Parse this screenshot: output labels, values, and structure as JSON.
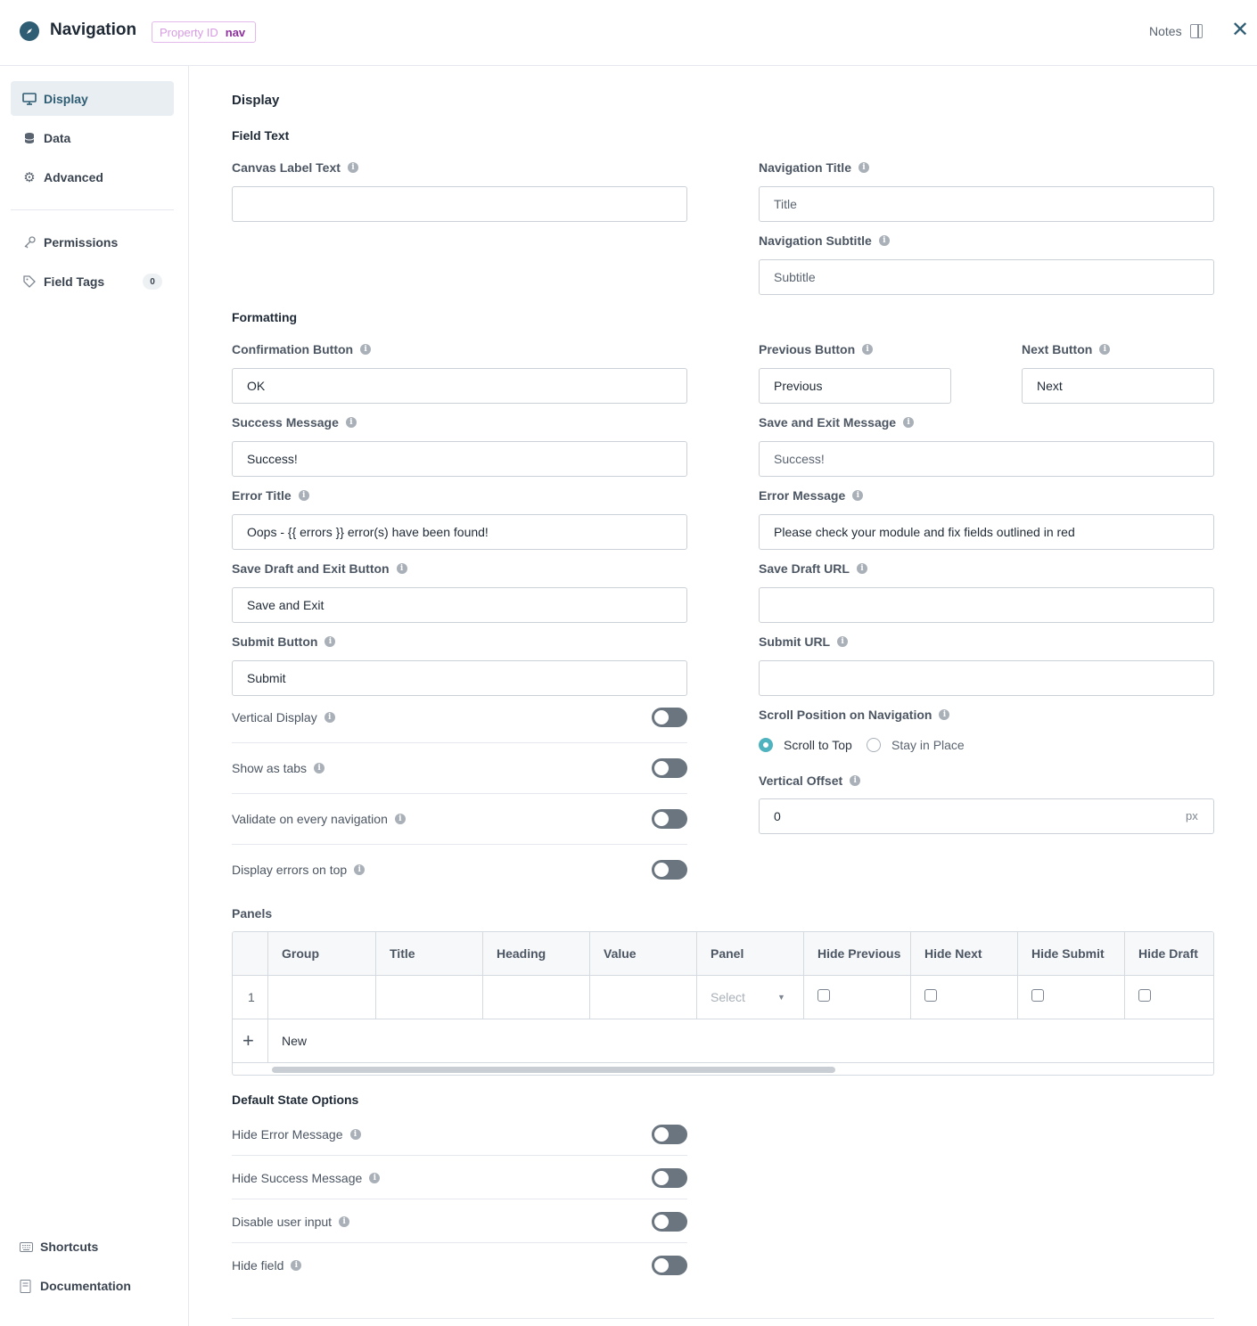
{
  "header": {
    "title": "Navigation",
    "property_label": "Property ID",
    "property_value": "nav",
    "notes_label": "Notes"
  },
  "sidebar": {
    "items": [
      {
        "label": "Display",
        "icon": "monitor-icon"
      },
      {
        "label": "Data",
        "icon": "database-icon"
      },
      {
        "label": "Advanced",
        "icon": "gear-icon"
      },
      {
        "label": "Permissions",
        "icon": "key-icon"
      },
      {
        "label": "Field Tags",
        "icon": "tag-icon",
        "badge": "0"
      }
    ],
    "footer": [
      {
        "label": "Shortcuts",
        "icon": "keyboard-icon"
      },
      {
        "label": "Documentation",
        "icon": "book-icon"
      }
    ]
  },
  "main": {
    "section_title": "Display",
    "field_text_title": "Field Text",
    "canvas_label": {
      "label": "Canvas Label Text",
      "value": ""
    },
    "nav_title": {
      "label": "Navigation Title",
      "placeholder": "Title"
    },
    "nav_subtitle": {
      "label": "Navigation Subtitle",
      "placeholder": "Subtitle"
    },
    "formatting_title": "Formatting",
    "confirmation": {
      "label": "Confirmation Button",
      "value": "OK"
    },
    "previous": {
      "label": "Previous Button",
      "value": "Previous"
    },
    "next": {
      "label": "Next Button",
      "value": "Next"
    },
    "success_msg": {
      "label": "Success Message",
      "value": "Success!"
    },
    "save_exit_msg": {
      "label": "Save and Exit Message",
      "placeholder": "Success!"
    },
    "error_title": {
      "label": "Error Title",
      "value": "Oops - {{ errors }} error(s) have been found!"
    },
    "error_msg": {
      "label": "Error Message",
      "value": "Please check your module and fix fields outlined in red"
    },
    "save_draft_btn": {
      "label": "Save Draft and Exit Button",
      "value": "Save and Exit"
    },
    "save_draft_url": {
      "label": "Save Draft URL",
      "value": ""
    },
    "submit_btn": {
      "label": "Submit Button",
      "value": "Submit"
    },
    "submit_url": {
      "label": "Submit URL",
      "value": ""
    },
    "toggles": [
      {
        "label": "Vertical Display",
        "on": false
      },
      {
        "label": "Show as tabs",
        "on": false
      },
      {
        "label": "Validate on every navigation",
        "on": false
      },
      {
        "label": "Display errors on top",
        "on": false
      }
    ],
    "scroll_position": {
      "label": "Scroll Position on Navigation",
      "options": [
        "Scroll to Top",
        "Stay in Place"
      ],
      "selected": "Scroll to Top"
    },
    "vertical_offset": {
      "label": "Vertical Offset",
      "value": "0",
      "unit": "px"
    },
    "panels": {
      "title": "Panels",
      "columns": [
        "Group",
        "Title",
        "Heading",
        "Value",
        "Panel",
        "Hide Previous",
        "Hide Next",
        "Hide Submit",
        "Hide Draft"
      ],
      "rows": [
        {
          "index": "1",
          "panel_select": "Select"
        }
      ],
      "new_label": "New"
    },
    "default_state": {
      "title": "Default State Options",
      "toggles": [
        {
          "label": "Hide Error Message",
          "on": false
        },
        {
          "label": "Hide Success Message",
          "on": false
        },
        {
          "label": "Disable user input",
          "on": false
        },
        {
          "label": "Hide field",
          "on": false
        }
      ]
    }
  },
  "colors": {
    "accent": "#2f5d73",
    "radio": "#4fb3bf",
    "badge_border": "#e3b8ea",
    "badge_text": "#8e2f9e"
  }
}
